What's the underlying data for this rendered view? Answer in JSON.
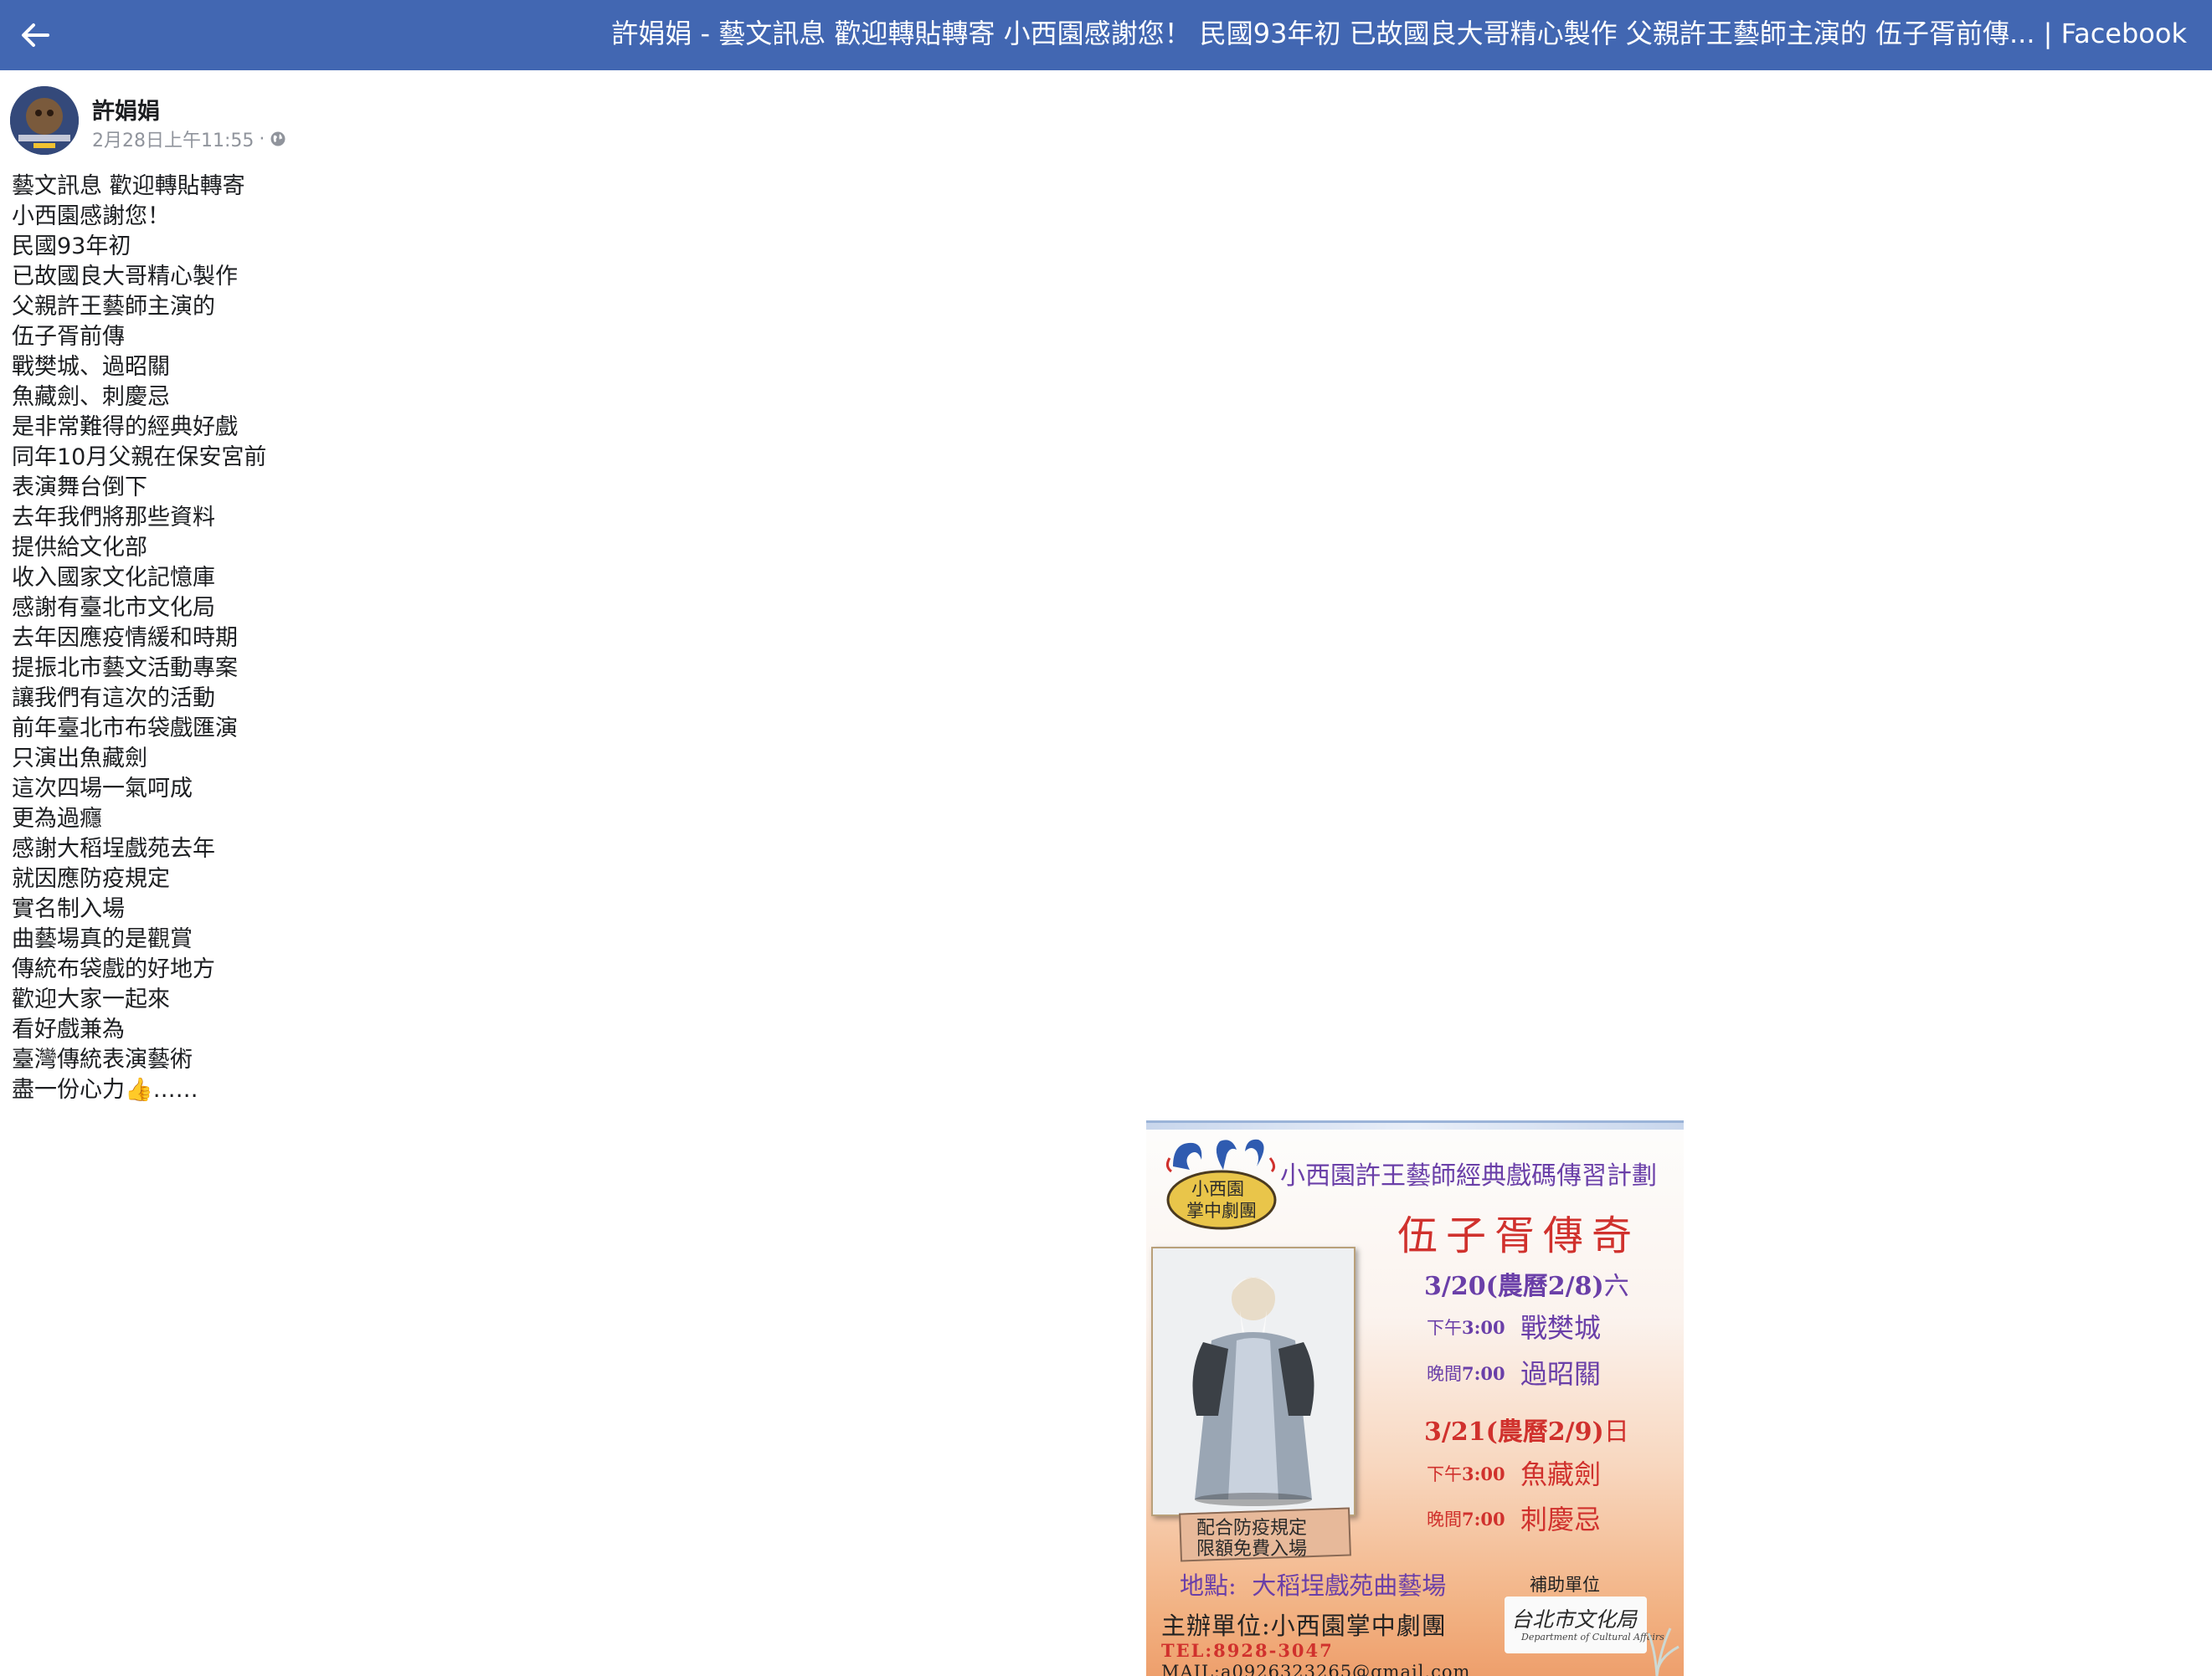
{
  "header": {
    "title": "許娟娟 - 藝文訊息 歡迎轉貼轉寄 小西園感謝您！ 民國93年初 已故國良大哥精心製作 父親許王藝師主演的 伍子胥前傳... | Facebook",
    "back_icon": "arrow-left-icon",
    "background": "#4267b2"
  },
  "post": {
    "author": "許娟娟",
    "timestamp": "2月28日上午11:55",
    "separator": "·",
    "privacy_icon": "globe-icon",
    "lines": [
      "藝文訊息 歡迎轉貼轉寄",
      "小西園感謝您！",
      "民國93年初",
      "已故國良大哥精心製作",
      "父親許王藝師主演的",
      "伍子胥前傳",
      "戰樊城、過昭關",
      "魚藏劍、刺慶忌",
      "是非常難得的經典好戲",
      "同年10月父親在保安宮前",
      "表演舞台倒下",
      "去年我們將那些資料",
      "提供給文化部",
      "收入國家文化記憶庫",
      "感謝有臺北市文化局",
      "去年因應疫情緩和時期",
      "提振北市藝文活動專案",
      "讓我們有這次的活動",
      "前年臺北市布袋戲匯演",
      "只演出魚藏劍",
      "這次四場一氣呵成",
      "更為過癮",
      "感謝大稻埕戲苑去年",
      "就因應防疫規定",
      "實名制入場",
      "曲藝場真的是觀賞",
      "傳統布袋戲的好地方",
      "歡迎大家一起來",
      "看好戲兼為",
      "臺灣傳統表演藝術",
      "盡一份心力👍……"
    ]
  },
  "poster": {
    "logo_text_line1": "小西園",
    "logo_text_line2": "掌中劇團",
    "plan_title": "小西園許王藝師經典戲碼傳習計劃",
    "show_title": "伍子胥傳奇",
    "day1": "3/20(農曆2/8)",
    "day1_weekday": "六",
    "day1_s1_time_label": "下午",
    "day1_s1_time": "3:00",
    "day1_s1_play": "戰樊城",
    "day1_s2_time_label": "晚間",
    "day1_s2_time": "7:00",
    "day1_s2_play": "過昭關",
    "day2": "3/21(農曆2/9)",
    "day2_weekday": "日",
    "day2_s1_time_label": "下午",
    "day2_s1_time": "3:00",
    "day2_s1_play": "魚藏劍",
    "day2_s2_time_label": "晚間",
    "day2_s2_time": "7:00",
    "day2_s2_play": "刺慶忌",
    "notice_line1": "配合防疫規定",
    "notice_line2": "限額免費入場",
    "venue_label": "地點:",
    "venue": "大稻埕戲苑曲藝場",
    "sponsor_label": "補助單位",
    "organizer": "主辦單位:小西園掌中劇團",
    "tel": "TEL:8928-3047",
    "mail": "MAIL:a0926323265@gmail.com",
    "sponsor_logo_text": "台北市文化局",
    "sponsor_logo_en": "Department of Cultural Affairs",
    "colors": {
      "purple": "#6a3fa8",
      "red": "#d0312d",
      "dark": "#222222"
    }
  }
}
